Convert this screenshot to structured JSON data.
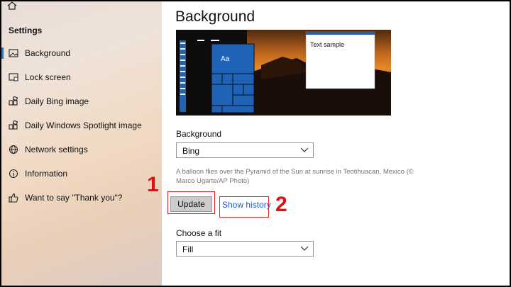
{
  "sidebar": {
    "title": "Settings",
    "items": [
      {
        "label": "Background",
        "icon": "image-icon",
        "selected": true
      },
      {
        "label": "Lock screen",
        "icon": "lock-screen-icon"
      },
      {
        "label": "Daily Bing image",
        "icon": "puzzle-icon"
      },
      {
        "label": "Daily Windows Spotlight image",
        "icon": "puzzle-icon"
      },
      {
        "label": "Network settings",
        "icon": "globe-icon"
      },
      {
        "label": "Information",
        "icon": "info-icon"
      },
      {
        "label": "Want to say \"Thank you\"?",
        "icon": "thumbs-up-icon"
      }
    ]
  },
  "main": {
    "title": "Background",
    "preview": {
      "tile_text": "Aa",
      "window_text": "Text sample"
    },
    "background_section": {
      "label": "Background",
      "selected": "Bing"
    },
    "caption": "A balloon flies over the Pyramid of the Sun at sunrise in Teotihuacan, Mexico (© Marco Ugarte/AP Photo)",
    "update_button": "Update",
    "show_history_link": "Show history",
    "fit_section": {
      "label": "Choose a fit",
      "selected": "Fill"
    }
  },
  "annotations": {
    "one": "1",
    "two": "2"
  },
  "colors": {
    "accent": "#1f57c2",
    "highlight": "#e02020",
    "tile_blue": "#1e63b8"
  }
}
